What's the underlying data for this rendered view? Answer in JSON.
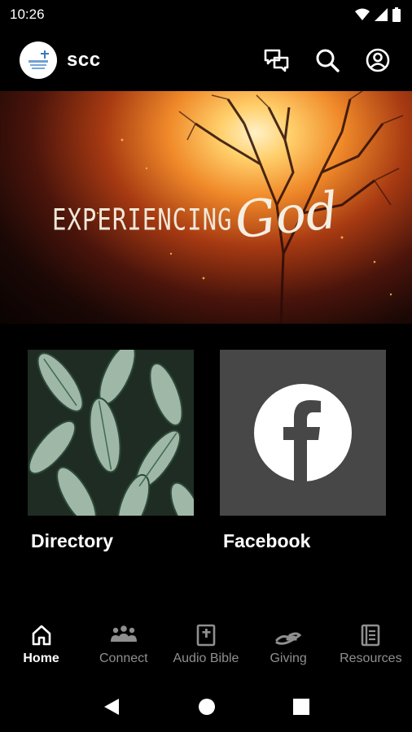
{
  "status_bar": {
    "time": "10:26"
  },
  "app_bar": {
    "title": "scc",
    "logo_text": "SCC",
    "actions": [
      "chat-icon",
      "search-icon",
      "account-icon"
    ]
  },
  "hero": {
    "line1": "EXPERIENCING",
    "line2": "God"
  },
  "tiles": [
    {
      "label": "Directory",
      "image": "leaf-plant"
    },
    {
      "label": "Facebook",
      "image": "facebook-icon"
    }
  ],
  "bottom_nav": {
    "items": [
      {
        "label": "Home",
        "icon": "home-icon",
        "active": true
      },
      {
        "label": "Connect",
        "icon": "people-icon",
        "active": false
      },
      {
        "label": "Audio Bible",
        "icon": "bible-icon",
        "active": false
      },
      {
        "label": "Giving",
        "icon": "hand-icon",
        "active": false
      },
      {
        "label": "Resources",
        "icon": "book-icon",
        "active": false
      }
    ]
  },
  "colors": {
    "background": "#000000",
    "tile_bg": "#474747",
    "inactive": "#8f8f8f"
  }
}
